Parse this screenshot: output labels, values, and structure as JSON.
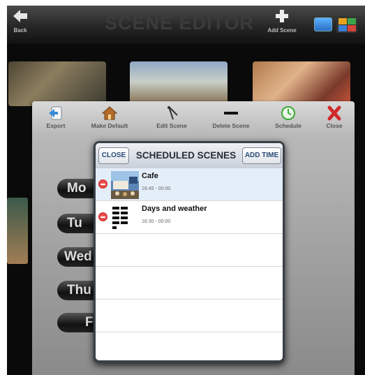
{
  "header": {
    "title": "SCENE EDITOR",
    "back_label": "Back",
    "add_scene_label": "Add Scene"
  },
  "toolbar": {
    "items": [
      {
        "label": "Export",
        "icon": "export-icon"
      },
      {
        "label": "Make Default",
        "icon": "house-icon"
      },
      {
        "label": "Edit Scene",
        "icon": "compass-icon"
      },
      {
        "label": "Delete Scene",
        "icon": "minus-icon"
      },
      {
        "label": "Schedule",
        "icon": "clock-icon"
      },
      {
        "label": "Close",
        "icon": "close-icon"
      }
    ]
  },
  "days": [
    "Mo",
    "Tu",
    "Wed",
    "Thu",
    "F"
  ],
  "popover": {
    "close_label": "CLOSE",
    "title": "SCHEDULED SCENES",
    "add_time_label": "ADD TIME",
    "scenes": [
      {
        "name": "Cafe",
        "time": "16:45 - 00:00",
        "selected": true
      },
      {
        "name": "Days and weather",
        "time": "16:30 - 00:00",
        "selected": false
      }
    ]
  },
  "colors": {
    "selected_row": "#e4eef9",
    "popover_title_text": "#2b4a76",
    "delete_red": "#c41a1a",
    "schedule_green": "#3aa83a",
    "close_red": "#d02a2a"
  }
}
